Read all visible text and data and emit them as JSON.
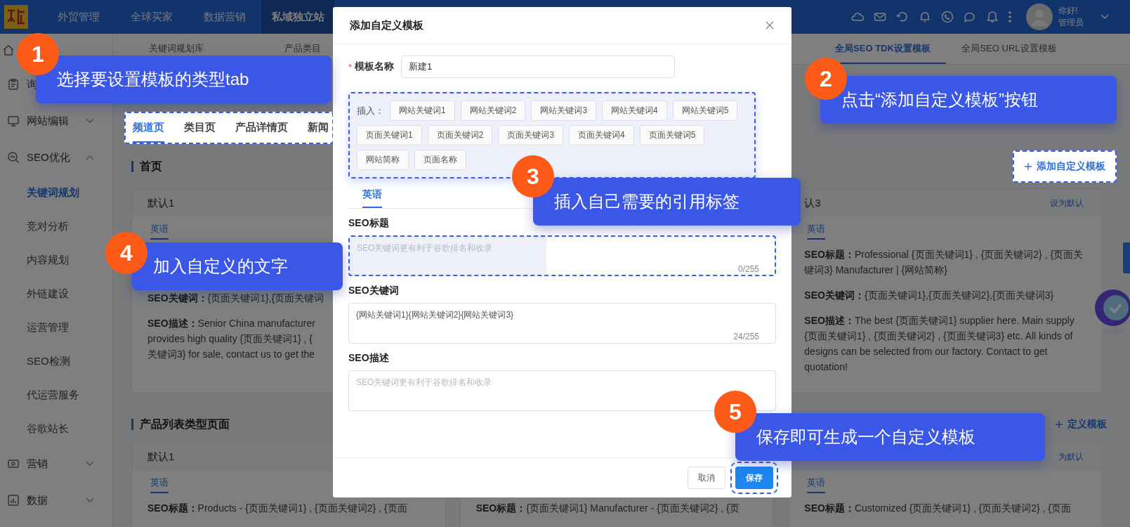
{
  "top_nav": {
    "items": [
      {
        "label": "外贸管理",
        "selected": false
      },
      {
        "label": "全球买家",
        "selected": false
      },
      {
        "label": "数据营销",
        "selected": false
      },
      {
        "label": "私域独立站",
        "selected": true
      }
    ],
    "user": {
      "greeting": "你好!",
      "role": "管理员"
    }
  },
  "sidebar": {
    "items": [
      {
        "label": "询"
      },
      {
        "label": "网站编辑",
        "expanded": false
      },
      {
        "label": "SEO优化",
        "expanded": true,
        "children": [
          {
            "label": "关键词规划",
            "selected": true
          },
          {
            "label": "竞对分析",
            "selected": false
          },
          {
            "label": "内容规划",
            "selected": false
          },
          {
            "label": "外链建设",
            "selected": false
          },
          {
            "label": "运营管理",
            "selected": false
          },
          {
            "label": "SEO检测",
            "selected": false
          },
          {
            "label": "代运营服务",
            "selected": false
          },
          {
            "label": "谷歌站长",
            "selected": false
          }
        ]
      },
      {
        "label": "营销",
        "expanded": false
      },
      {
        "label": "数据",
        "expanded": false
      }
    ]
  },
  "sub_tabs": [
    {
      "label": "关键词规划库",
      "selected": false
    },
    {
      "label": "产品类目",
      "selected": false
    },
    {
      "label": "全局SEO TDK设置模板",
      "selected": true
    },
    {
      "label": "全局SEO URL设置模板",
      "selected": false
    }
  ],
  "page_tabs": [
    {
      "label": "频道页",
      "selected": true
    },
    {
      "label": "类目页",
      "selected": false
    },
    {
      "label": "产品详情页",
      "selected": false
    },
    {
      "label": "新闻",
      "selected": false
    }
  ],
  "sections": [
    {
      "title": "首页",
      "add_button": "添加自定义模板",
      "cards": [
        {
          "name": "默认1",
          "language_tab": "英语",
          "fields": [
            {
              "label": "SEO关键词：",
              "lines": [
                "{页面关键词1},{页面关键词"
              ]
            },
            {
              "label": "SEO描述：",
              "lines": [
                "Senior China manufacturer",
                "provides high quality {页面关键词1} , {",
                "关键词3} for sale, contact us to get the"
              ]
            }
          ]
        },
        {
          "name": "认3",
          "default_link": "设为默认",
          "language_tab": "英语",
          "fields": [
            {
              "label": "SEO标题：",
              "text": "Professional {页面关键词1} , {页面关键词2} , {页面关键词3} Manufacturer | {网站简称}"
            },
            {
              "label": "SEO关键词：",
              "text": "{页面关键词1},{页面关键词2},{页面关键词3}"
            },
            {
              "label": "SEO描述：",
              "text": "The best {页面关键词1} supplier here. Main supply {页面关键词1} , {页面关键词2} , {页面关键词3} etc. All kinds of designs can be selected from our factory. Contact to get quotation!"
            }
          ]
        }
      ]
    },
    {
      "title": "产品列表类型页面",
      "add_button": "定义模板",
      "cards": [
        {
          "name": "默认1",
          "language_tab": "英语",
          "fields": [
            {
              "label": "SEO标题：",
              "lines": [
                "Products - {页面关键词1} , {页面关键词2} , {页面"
              ]
            }
          ]
        },
        {
          "fields": [
            {
              "label": "SEO标题：",
              "lines": [
                "{页面关键词1} Manufacturer - {页面关键词2} , {页"
              ]
            }
          ]
        },
        {
          "default_link": "为默认",
          "language_tab": "英语",
          "fields": [
            {
              "label": "SEO标题：",
              "lines": [
                "Customized {页面关键词1} , {页面关键词2} , {页面"
              ]
            }
          ]
        }
      ]
    }
  ],
  "modal": {
    "title": "添加自定义模板",
    "required_mark": "*",
    "name_label": "模板名称",
    "name_value": "新建1",
    "insert_label": "插入：",
    "insert_tags": [
      "网站关键词1",
      "网站关键词2",
      "网站关键词3",
      "网站关键词4",
      "网站关键词5",
      "页面关键词1",
      "页面关键词2",
      "页面关键词3",
      "页面关键词4",
      "页面关键词5",
      "网站简称",
      "页面名称"
    ],
    "language_tabs": [
      {
        "label": "英语",
        "selected": true
      }
    ],
    "fields": [
      {
        "label": "SEO标题",
        "placeholder": "SEO关键词更有利于谷歌排名和收录",
        "count": "0/255",
        "highlighted": true
      },
      {
        "label": "SEO关键词",
        "value": "{网站关键词1}{网站关键词2}{网站关键词3}",
        "count": "24/255",
        "highlighted": false
      },
      {
        "label": "SEO描述",
        "placeholder": "SEO关键词更有利于谷歌排名和收录",
        "highlighted": false
      }
    ],
    "buttons": [
      {
        "label": "取消",
        "kind": "secondary"
      },
      {
        "label": "保存",
        "kind": "primary"
      }
    ]
  },
  "callouts": [
    {
      "number": "1",
      "text": "选择要设置模板的类型tab"
    },
    {
      "number": "2",
      "text": "点击“添加自定义模板”按钮"
    },
    {
      "number": "3",
      "text": "插入自己需要的引用标签"
    },
    {
      "number": "4",
      "text": "加入自定义的文字"
    },
    {
      "number": "5",
      "text": "保存即可生成一个自定义模板"
    }
  ]
}
